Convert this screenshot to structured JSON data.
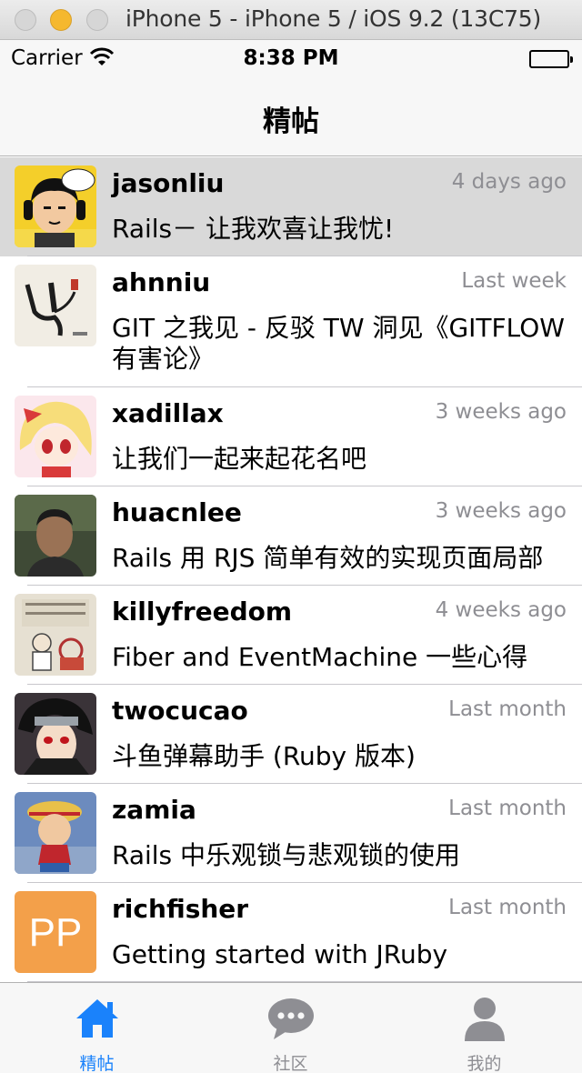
{
  "window": {
    "title": "iPhone 5 - iPhone 5 / iOS 9.2 (13C75)"
  },
  "status_bar": {
    "carrier": "Carrier",
    "time": "8:38 PM"
  },
  "nav": {
    "title": "精帖"
  },
  "topics": [
    {
      "user": "jasonliu",
      "time": "4 days ago",
      "title": "Rails－ 让我欢喜让我忧!",
      "avatar": "avatar-cartoon-headphones"
    },
    {
      "user": "ahnniu",
      "time": "Last week",
      "title": "GIT 之我见 - 反驳 TW 洞见《GITFLOW 有害论》",
      "avatar": "avatar-ink-drawing"
    },
    {
      "user": "xadillax",
      "time": "3 weeks ago",
      "title": "让我们一起来起花名吧",
      "avatar": "avatar-anime-girl"
    },
    {
      "user": "huacnlee",
      "time": "3 weeks ago",
      "title": "Rails 用 RJS 简单有效的实现页面局部",
      "avatar": "avatar-photo-man"
    },
    {
      "user": "killyfreedom",
      "time": "4 weeks ago",
      "title": "Fiber and EventMachine 一些心得",
      "avatar": "avatar-sketch"
    },
    {
      "user": "twocucao",
      "time": "Last month",
      "title": "斗鱼弹幕助手 (Ruby 版本)",
      "avatar": "avatar-anime-ninja"
    },
    {
      "user": "zamia",
      "time": "Last month",
      "title": "Rails 中乐观锁与悲观锁的使用",
      "avatar": "avatar-anime-pirate"
    },
    {
      "user": "richfisher",
      "time": "Last month",
      "title": "Getting started with JRuby",
      "avatar": "avatar-initials",
      "initials": "PP"
    }
  ],
  "tabs": [
    {
      "label": "精帖",
      "icon": "home-icon",
      "active": true
    },
    {
      "label": "社区",
      "icon": "chat-bubble-icon",
      "active": false
    },
    {
      "label": "我的",
      "icon": "person-icon",
      "active": false
    }
  ],
  "colors": {
    "accent": "#1a82fb",
    "inactive": "#8e8e93",
    "selected_row": "#d9d9d9",
    "initials_avatar": "#f3a04a"
  }
}
